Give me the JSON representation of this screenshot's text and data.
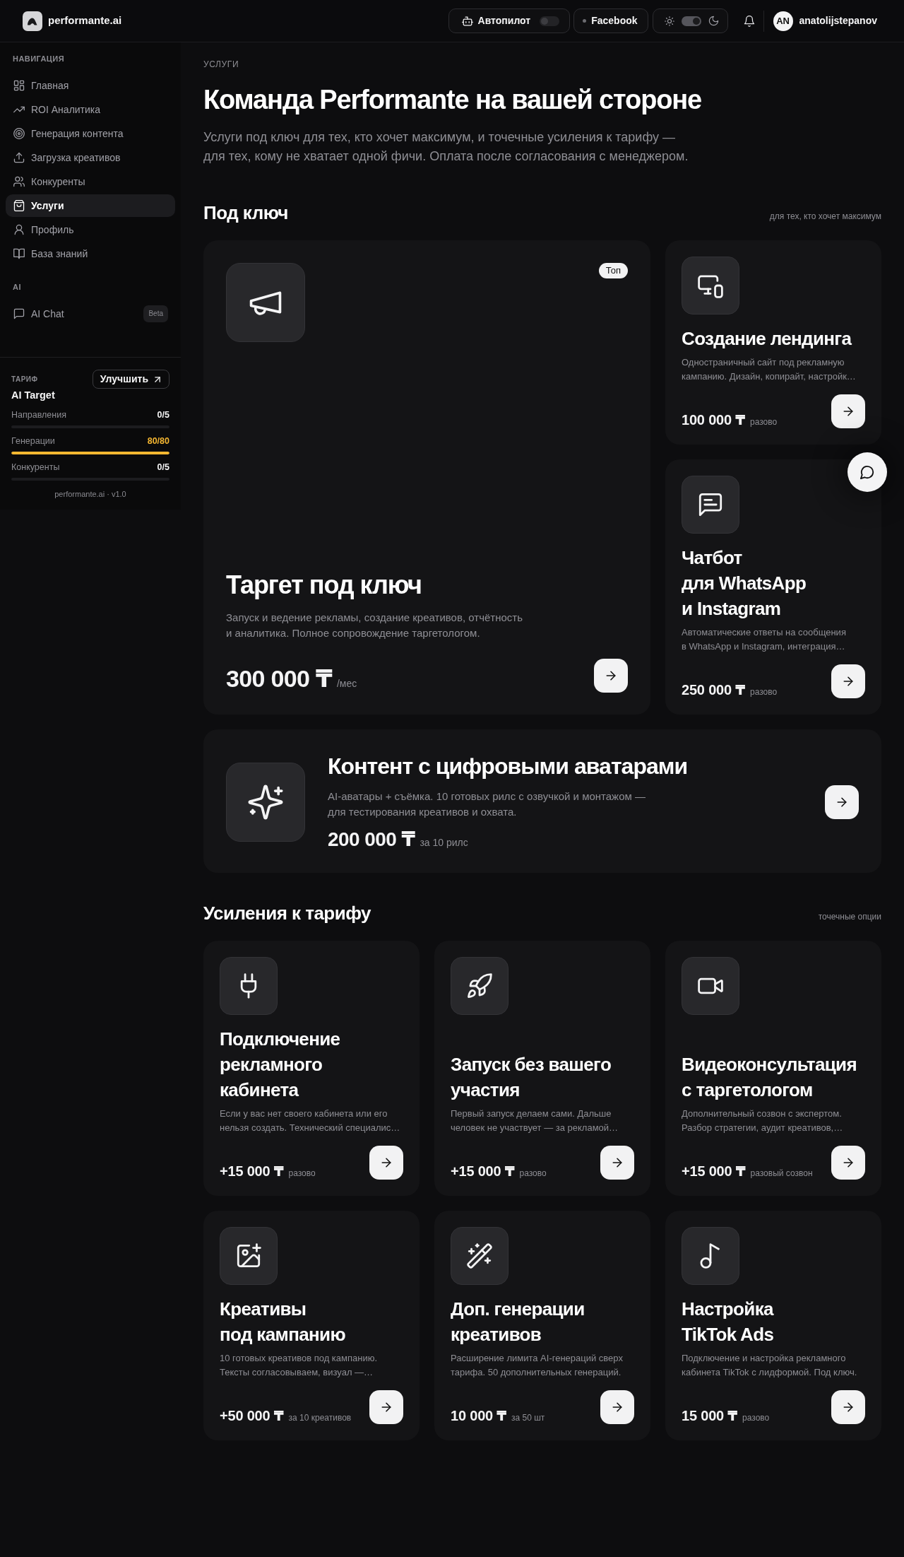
{
  "header": {
    "brand": "performante.ai",
    "autopilot": {
      "label": "Автопилот",
      "on": false
    },
    "platform": {
      "label": "Facebook"
    },
    "theme_switch": {
      "on": true
    },
    "user": {
      "initials": "AN",
      "name": "anatolijstepanov"
    }
  },
  "sidebar": {
    "sections": [
      {
        "title": "НАВИГАЦИЯ",
        "items": [
          {
            "label": "Главная",
            "selected": false
          },
          {
            "label": "ROI Аналитика",
            "selected": false
          },
          {
            "label": "Генерация контента",
            "selected": false
          },
          {
            "label": "Загрузка креативов",
            "selected": false
          },
          {
            "label": "Конкуренты",
            "selected": false
          },
          {
            "label": "Услуги",
            "selected": true
          },
          {
            "label": "Профиль",
            "selected": false
          },
          {
            "label": "База знаний",
            "selected": false
          }
        ]
      },
      {
        "title": "AI",
        "items": [
          {
            "label": "AI Chat",
            "selected": false,
            "badge": "Beta"
          }
        ]
      }
    ],
    "plan": {
      "title": "ТАРИФ",
      "upgrade": "Улучшить",
      "name": "AI Target",
      "limits": [
        {
          "label": "Направления",
          "value": "0/5",
          "level": 0
        },
        {
          "label": "Генерации",
          "value": "80/80",
          "level": 1
        },
        {
          "label": "Конкуренты",
          "value": "0/5",
          "level": 0
        }
      ]
    },
    "footer": "performante.ai · v1.0"
  },
  "page": {
    "eyebrow": "УСЛУГИ",
    "title": "Команда Performante на вашей стороне",
    "subtitle": "Услуги под ключ для тех, кто хочет максимум, и точечные усиления к тарифу —\nдля тех, кому не хватает одной фичи. Оплата после согласования с менеджером."
  },
  "sections": [
    {
      "title": "Под ключ",
      "note": "для тех, кто хочет максимум",
      "cards": [
        {
          "kind": "featured",
          "badge": "Топ",
          "title": "Таргет под ключ",
          "description": "Запуск и ведение рекламы, создание креативов, отчётность\nи аналитика. Полное сопровождение таргетологом.",
          "price": "300 000 ₸",
          "period": "/мес"
        },
        {
          "kind": "compact",
          "title": "Создание лендинга",
          "description": "Одностраничный сайт под рекламную\nкампанию. Дизайн, копирайт, настройк…",
          "price": "100 000 ₸",
          "period": "разово"
        },
        {
          "kind": "compact",
          "title": "Чатбот\nдля WhatsApp\nи Instagram",
          "description": "Автоматические ответы на сообщения\nв WhatsApp и Instagram, интеграция…",
          "price": "250 000 ₸",
          "period": "разово"
        },
        {
          "kind": "wide",
          "title": "Контент с цифровыми аватарами",
          "description": "AI-аватары + съёмка. 10 готовых рилс с озвучкой и монтажом —\nдля тестирования креативов и охвата.",
          "price": "200 000 ₸",
          "period": "за 10 рилс"
        }
      ]
    },
    {
      "title": "Усиления к тарифу",
      "note": "точечные опции",
      "cards": [
        {
          "kind": "compact",
          "title": "Подключение\nрекламного\nкабинета",
          "description": "Если у вас нет своего кабинета или его\nнельзя создать. Технический специалис…",
          "price": "+15 000 ₸",
          "period": "разово"
        },
        {
          "kind": "compact",
          "title": "Запуск без вашего\nучастия",
          "description": "Первый запуск делаем сами. Дальше\nчеловек не участвует — за рекламой…",
          "price": "+15 000 ₸",
          "period": "разово"
        },
        {
          "kind": "compact",
          "title": "Видеоконсультация\nс таргетологом",
          "description": "Дополнительный созвон с экспертом.\nРазбор стратегии, аудит креативов,…",
          "price": "+15 000 ₸",
          "period": "разовый созвон"
        },
        {
          "kind": "compact",
          "title": "Креативы\nпод кампанию",
          "description": "10 готовых креативов под кампанию.\nТексты согласовываем, визуал —…",
          "price": "+50 000 ₸",
          "period": "за 10 креативов"
        },
        {
          "kind": "compact",
          "title": "Доп. генерации\nкреативов",
          "description": "Расширение лимита AI-генераций сверх\nтарифа. 50 дополнительных генераций.",
          "price": "10 000 ₸",
          "period": "за 50 шт"
        },
        {
          "kind": "compact",
          "title": "Настройка\nTikTok Ads",
          "description": "Подключение и настройка рекламного\nкабинета TikTok с лидформой. Под ключ.",
          "price": "15 000 ₸",
          "period": "разово"
        }
      ]
    }
  ]
}
